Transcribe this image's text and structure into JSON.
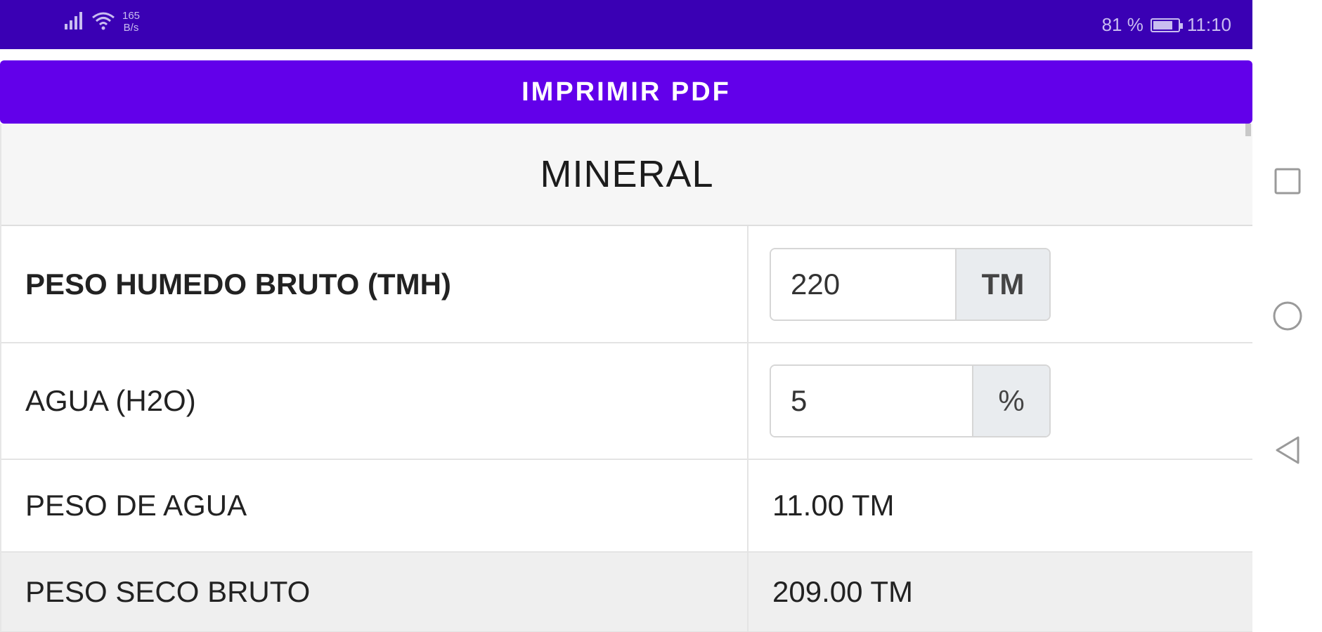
{
  "status_bar": {
    "net_speed_value": "165",
    "net_speed_unit": "B/s",
    "battery_text": "81 %",
    "battery_level": 0.81,
    "time": "11:10"
  },
  "actions": {
    "print_pdf_label": "IMPRIMIR PDF"
  },
  "section": {
    "title": "MINERAL"
  },
  "rows": [
    {
      "label": "PESO HUMEDO BRUTO (TMH)",
      "value": "220",
      "unit": "TM"
    },
    {
      "label": "AGUA (H2O)",
      "value": "5",
      "unit": "%"
    },
    {
      "label": "PESO DE AGUA",
      "value": "11.00 TM"
    },
    {
      "label": "PESO SECO BRUTO",
      "value": "209.00 TM"
    }
  ],
  "colors": {
    "status_bar": "#3a00b4",
    "primary": "#6200ea"
  },
  "icons": [
    "signal-icon",
    "wifi-icon",
    "battery-icon",
    "recent-apps-icon",
    "home-icon",
    "back-icon"
  ]
}
